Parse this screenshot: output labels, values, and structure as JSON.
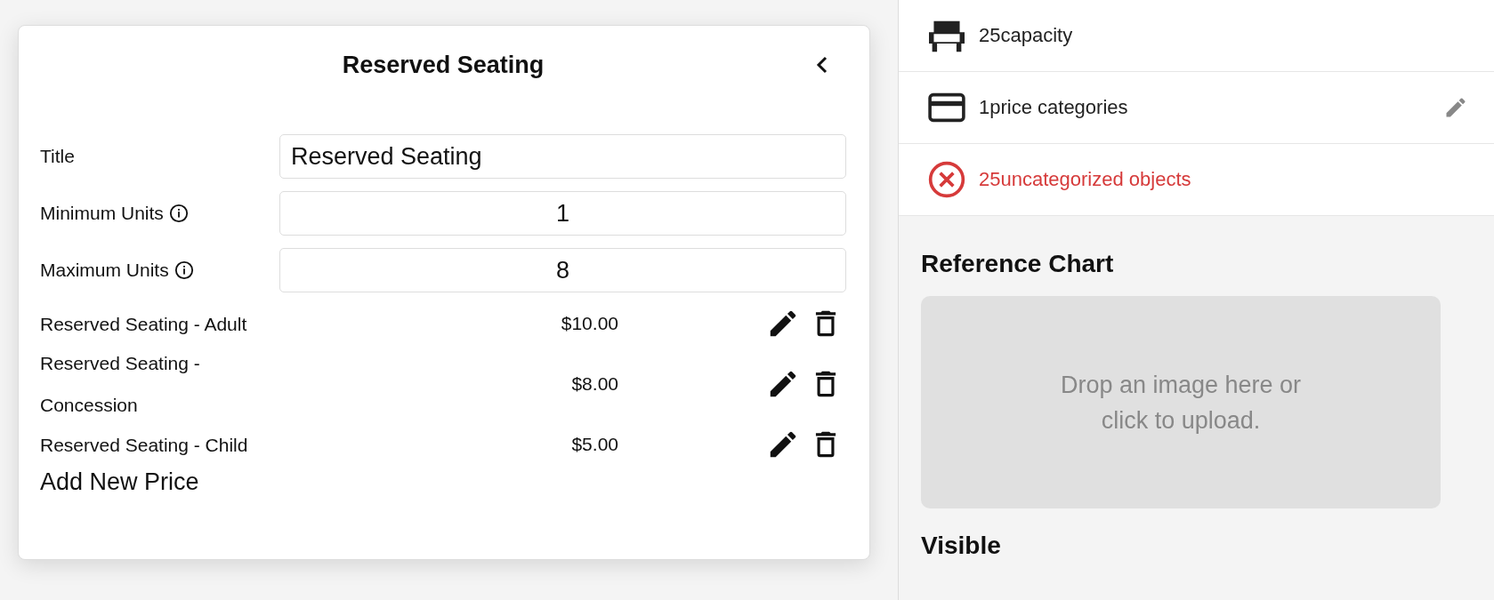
{
  "dialog": {
    "title": "Reserved Seating",
    "fields": [
      {
        "kind": "text",
        "label": "Title",
        "value": "Reserved Seating",
        "info": false
      },
      {
        "kind": "number",
        "label": "Minimum Units",
        "value": "1",
        "info": true
      },
      {
        "kind": "number",
        "label": "Maximum Units",
        "value": "8",
        "info": true
      }
    ],
    "prices": [
      {
        "name": "Reserved Seating - Adult",
        "price": "$10.00"
      },
      {
        "name": "Reserved Seating - Concession",
        "price": "$8.00"
      },
      {
        "name": "Reserved Seating - Child",
        "price": "$5.00"
      }
    ],
    "add_button": "Add New Price"
  },
  "summary": [
    {
      "kind": "capacity",
      "text": "25capacity",
      "editable": false
    },
    {
      "kind": "price",
      "text": "1price categories",
      "editable": true
    },
    {
      "kind": "error",
      "text": "25uncategorized objects",
      "editable": false
    }
  ],
  "reference_chart": {
    "heading": "Reference Chart",
    "dropzone": "Drop an image here or click to upload."
  },
  "visible": {
    "heading": "Visible"
  }
}
